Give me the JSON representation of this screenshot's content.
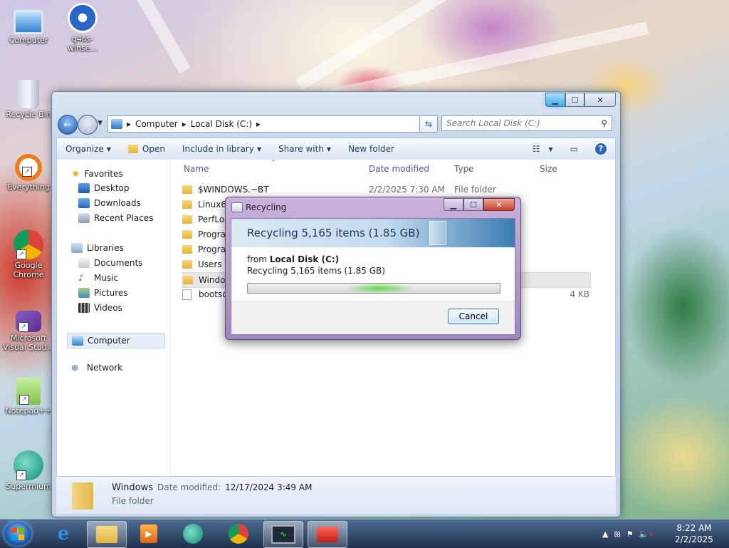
{
  "desktop": {
    "icons": [
      {
        "label": "Computer"
      },
      {
        "label": "q4os-winse..."
      },
      {
        "label": "Recycle Bin"
      },
      {
        "label": "Everything"
      },
      {
        "label": "Google Chrome"
      },
      {
        "label": "Microsoft Visual Stud..."
      },
      {
        "label": "Notepad++"
      },
      {
        "label": "Supermium"
      }
    ]
  },
  "explorer": {
    "breadcrumb": [
      "Computer",
      "Local Disk (C:)"
    ],
    "search_placeholder": "Search Local Disk (C:)",
    "toolbar": {
      "organize": "Organize",
      "open": "Open",
      "include_in_library": "Include in library",
      "share_with": "Share with",
      "new_folder": "New folder"
    },
    "nav": {
      "favorites": "Favorites",
      "favorites_items": [
        "Desktop",
        "Downloads",
        "Recent Places"
      ],
      "libraries": "Libraries",
      "libraries_items": [
        "Documents",
        "Music",
        "Pictures",
        "Videos"
      ],
      "computer": "Computer",
      "network": "Network"
    },
    "columns": {
      "name": "Name",
      "date": "Date modified",
      "type": "Type",
      "size": "Size"
    },
    "files": [
      {
        "name": "$WINDOWS.~BT",
        "date": "2/2/2025 7:30 AM",
        "type": "File folder",
        "size": "",
        "kind": "folder"
      },
      {
        "name": "Linux64",
        "date": "",
        "type": "",
        "size": "",
        "kind": "folder"
      },
      {
        "name": "PerfLog",
        "date": "",
        "type": "",
        "size": "",
        "kind": "folder"
      },
      {
        "name": "Program",
        "date": "",
        "type": "",
        "size": "",
        "kind": "folder"
      },
      {
        "name": "Program",
        "date": "",
        "type": "",
        "size": "",
        "kind": "folder"
      },
      {
        "name": "Users",
        "date": "",
        "type": "",
        "size": "",
        "kind": "folder"
      },
      {
        "name": "Window",
        "date": "",
        "type": "",
        "size": "",
        "kind": "folder"
      },
      {
        "name": "bootsq",
        "date": "",
        "type": "",
        "size": "4 KB",
        "kind": "file"
      }
    ],
    "details": {
      "name": "Windows",
      "date_label": "Date modified:",
      "date_value": "12/17/2024 3:49 AM",
      "type": "File folder"
    }
  },
  "dialog": {
    "title": "Recycling",
    "heading": "Recycling 5,165 items (1.85 GB)",
    "from_label": "from",
    "from_value": "Local Disk (C:)",
    "status": "Recycling 5,165 items (1.85 GB)",
    "cancel": "Cancel"
  },
  "taskbar": {
    "time": "8:22 AM",
    "date": "2/2/2025"
  }
}
